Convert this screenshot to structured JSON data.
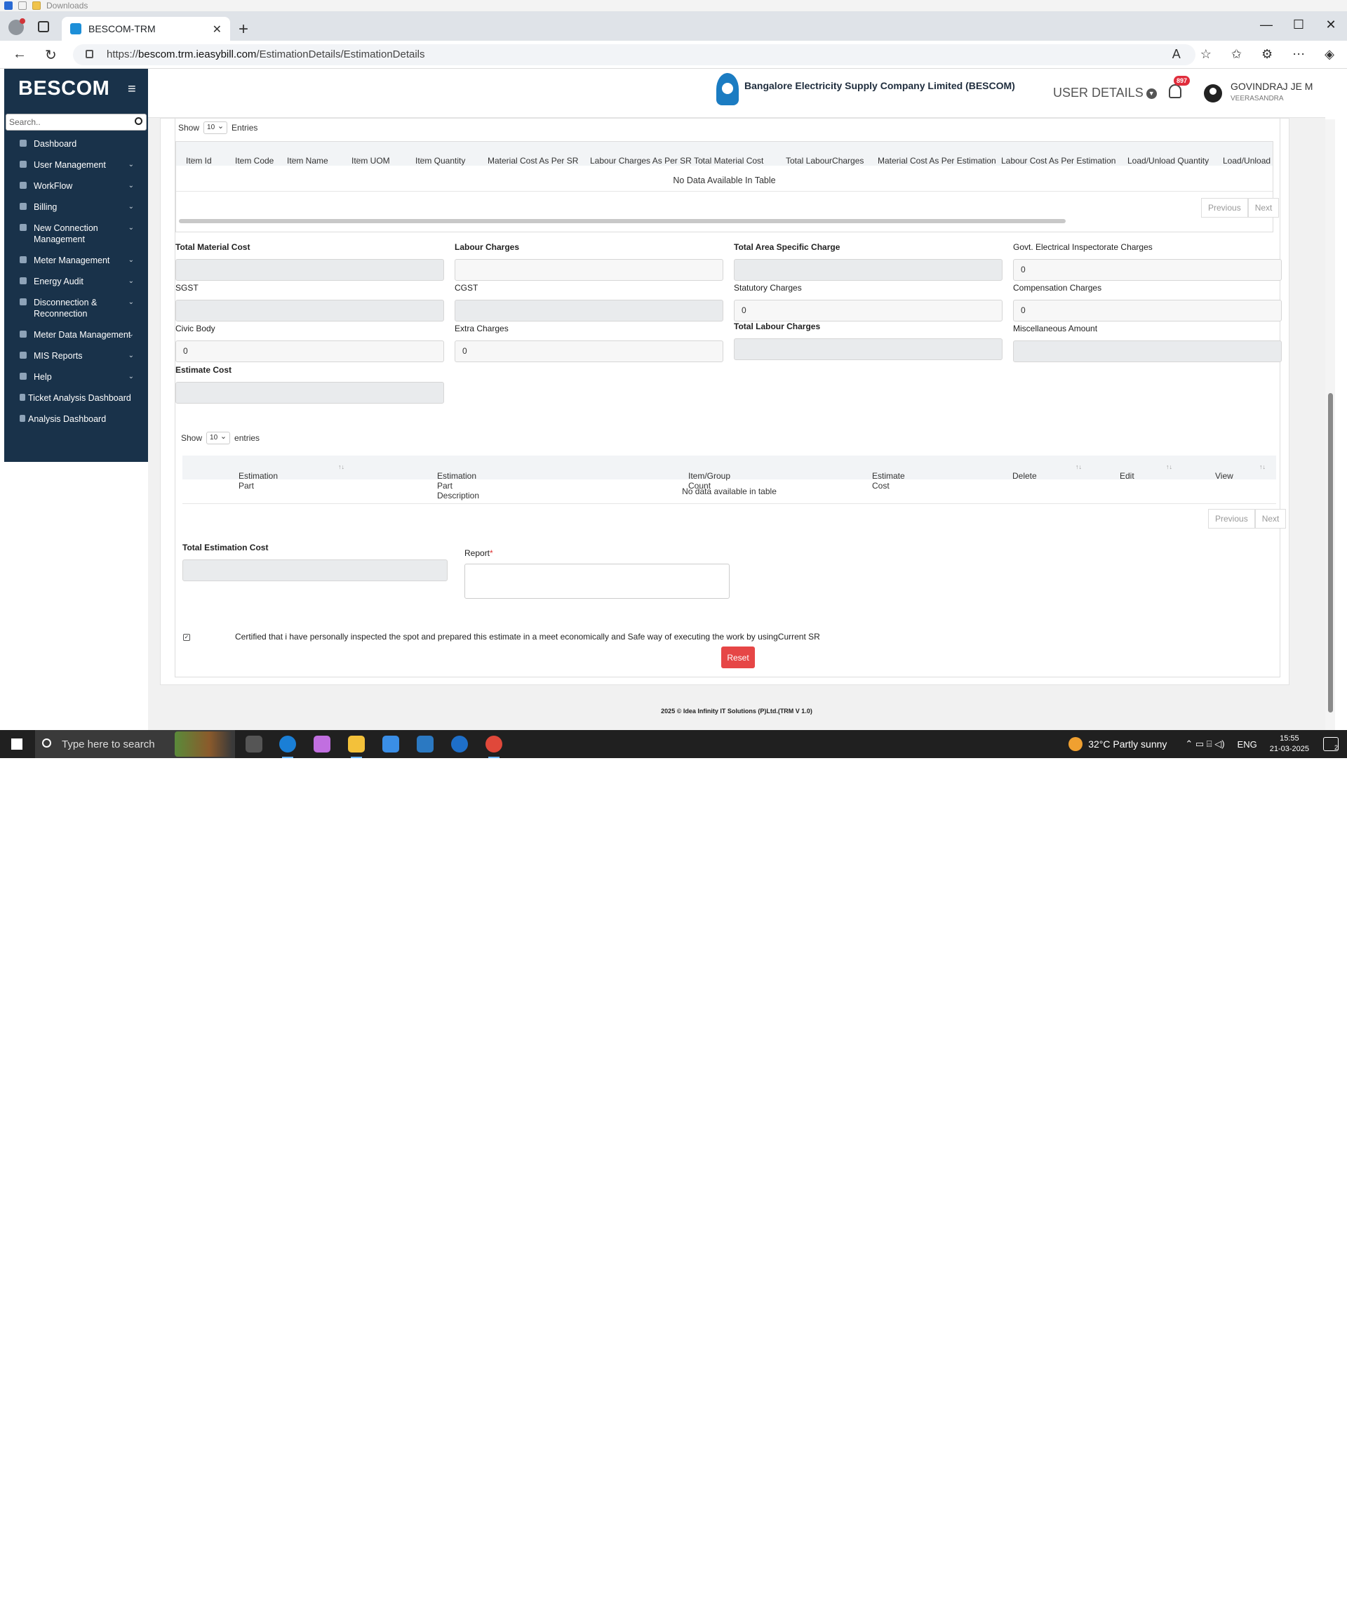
{
  "os_strip": {
    "label": "Downloads"
  },
  "browser": {
    "tab_title": "BESCOM-TRM",
    "url_prefix": "https://",
    "url_host": "bescom.trm.ieasybill.com",
    "url_path": "/EstimationDetails/EstimationDetails"
  },
  "sidebar": {
    "brand": "BESCOM",
    "search_placeholder": "Search..",
    "items": [
      {
        "label": "Dashboard",
        "expandable": false
      },
      {
        "label": "User Management",
        "expandable": true
      },
      {
        "label": "WorkFlow",
        "expandable": true
      },
      {
        "label": "Billing",
        "expandable": true
      },
      {
        "label": "New Connection Management",
        "expandable": true
      },
      {
        "label": "Meter Management",
        "expandable": true
      },
      {
        "label": "Energy Audit",
        "expandable": true
      },
      {
        "label": "Disconnection & Reconnection",
        "expandable": true
      },
      {
        "label": "Meter Data Management",
        "expandable": true
      },
      {
        "label": "MIS Reports",
        "expandable": true
      },
      {
        "label": "Help",
        "expandable": true
      },
      {
        "label": "Ticket Analysis Dashboard",
        "expandable": false
      },
      {
        "label": "Analysis Dashboard",
        "expandable": false
      }
    ]
  },
  "header": {
    "company": "Bangalore Electricity Supply Company Limited (BESCOM)",
    "user_details": "USER DETAILS",
    "notification_count": "897",
    "user_name": "GOVINDRAJ JE M",
    "user_location": "VEERASANDRA"
  },
  "items_table": {
    "show_label": "Show",
    "page_size": "10",
    "entries_label": "Entries",
    "columns": [
      "Item Id",
      "Item Code",
      "Item Name",
      "Item UOM",
      "Item Quantity",
      "Material Cost As Per SR",
      "Labour Charges As Per SR",
      "Total Material Cost",
      "Total LabourCharges",
      "Material Cost As Per Estimation",
      "Labour Cost As Per Estimation",
      "Load/Unload Quantity",
      "Load/Unload Ch"
    ],
    "empty_text": "No Data Available In Table",
    "prev": "Previous",
    "next": "Next"
  },
  "fields": {
    "total_material_cost": {
      "label": "Total Material Cost",
      "value": ""
    },
    "labour_charges": {
      "label": "Labour Charges",
      "value": ""
    },
    "total_area_specific_charge": {
      "label": "Total Area Specific Charge",
      "value": ""
    },
    "govt_electrical_inspectorate_charges": {
      "label": "Govt. Electrical Inspectorate Charges",
      "value": "0"
    },
    "sgst": {
      "label": "SGST",
      "value": ""
    },
    "cgst": {
      "label": "CGST",
      "value": ""
    },
    "statutory_charges": {
      "label": "Statutory Charges",
      "value": "0"
    },
    "compensation_charges": {
      "label": "Compensation Charges",
      "value": "0"
    },
    "civic_body": {
      "label": "Civic Body",
      "value": "0"
    },
    "extra_charges": {
      "label": "Extra Charges",
      "value": "0"
    },
    "total_labour_charges": {
      "label": "Total Labour Charges",
      "value": ""
    },
    "miscellaneous_amount": {
      "label": "Miscellaneous Amount",
      "value": ""
    },
    "estimate_cost": {
      "label": "Estimate Cost",
      "value": ""
    }
  },
  "parts_table": {
    "show_label": "Show",
    "page_size": "10",
    "entries_label": "entries",
    "columns": [
      "Estimation Part",
      "Estimation Part Description",
      "Item/Group Count",
      "Estimate Cost",
      "Delete",
      "Edit",
      "View"
    ],
    "empty_text": "No data available in table",
    "prev": "Previous",
    "next": "Next"
  },
  "total_estimation_cost": {
    "label": "Total Estimation Cost",
    "value": ""
  },
  "report": {
    "label": "Report",
    "required_mark": "*"
  },
  "certification": {
    "checked": true,
    "text": "Certified that i have personally inspected the spot and prepared this estimate in a meet economically and Safe way of executing the work by usingCurrent SR"
  },
  "reset_button": "Reset",
  "footer": "2025 © Idea Infinity IT Solutions (P)Ltd.(TRM V 1.0)",
  "taskbar": {
    "search_placeholder": "Type here to search",
    "weather": "32°C  Partly sunny",
    "language": "ENG",
    "time": "15:55",
    "date": "21-03-2025",
    "notifications": "2"
  }
}
